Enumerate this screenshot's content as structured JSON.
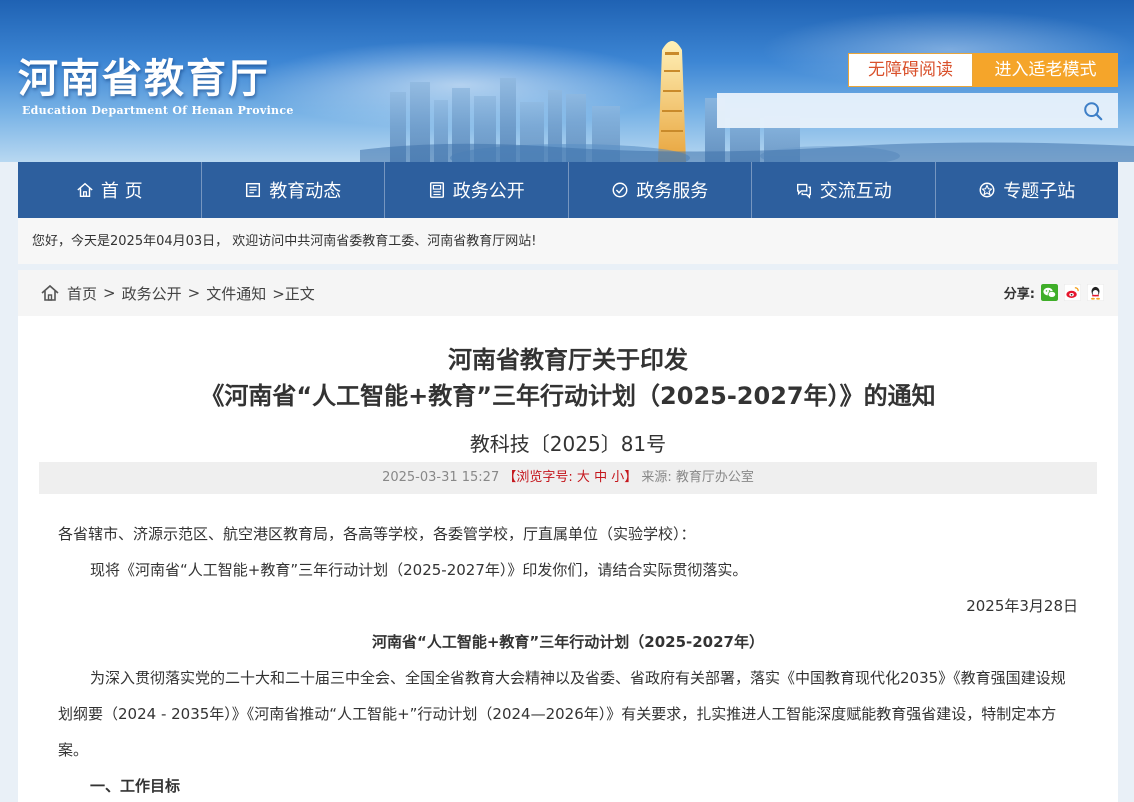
{
  "header": {
    "logo_cn": "河南省教育厅",
    "logo_en": "Education Department Of Henan Province",
    "btn_accessible": "无障碍阅读",
    "btn_elder": "进入适老模式",
    "search_placeholder": ""
  },
  "nav": {
    "items": [
      {
        "label": "首 页",
        "icon": "home-icon"
      },
      {
        "label": "教育动态",
        "icon": "news-icon"
      },
      {
        "label": "政务公开",
        "icon": "disclosure-icon"
      },
      {
        "label": "政务服务",
        "icon": "service-icon"
      },
      {
        "label": "交流互动",
        "icon": "interaction-icon"
      },
      {
        "label": "专题子站",
        "icon": "topic-icon"
      }
    ]
  },
  "welcome": "您好，今天是2025年04月03日， 欢迎访问中共河南省委教育工委、河南省教育厅网站!",
  "breadcrumb": {
    "items": [
      "首页",
      "政务公开",
      "文件通知"
    ],
    "current": ">正文",
    "separator": ">"
  },
  "share": {
    "label": "分享:",
    "icons": [
      "wechat-icon",
      "weibo-icon",
      "qq-icon"
    ]
  },
  "article": {
    "title_line1": "河南省教育厅关于印发",
    "title_line2": "《河南省“人工智能+教育”三年行动计划（2025-2027年）》的通知",
    "doc_no": "教科技〔2025〕81号",
    "meta": {
      "datetime": "2025-03-31 15:27",
      "font_prefix": "【浏览字号:",
      "font_large": "大",
      "font_medium": "中",
      "font_small": "小",
      "font_suffix": "】",
      "source": "来源: 教育厅办公室"
    },
    "addressee": "各省辖市、济源示范区、航空港区教育局，各高等学校，各委管学校，厅直属单位（实验学校）：",
    "para1": "现将《河南省“人工智能+教育”三年行动计划（2025-2027年）》印发你们，请结合实际贯彻落实。",
    "date": "2025年3月28日",
    "subtitle": "河南省“人工智能+教育”三年行动计划（2025-2027年）",
    "para2": "为深入贯彻落实党的二十大和二十届三中全会、全国全省教育大会精神以及省委、省政府有关部署，落实《中国教育现代化2035》《教育强国建设规划纲要（2024 - 2035年）》《河南省推动“人工智能+”行动计划（2024—2026年）》有关要求，扎实推进人工智能深度赋能教育强省建设，特制定本方案。",
    "section1": "一、工作目标"
  },
  "colors": {
    "nav_bg": "#2d5f9e",
    "accent_orange": "#f5a52a",
    "font_size_red": "#c4161c"
  }
}
